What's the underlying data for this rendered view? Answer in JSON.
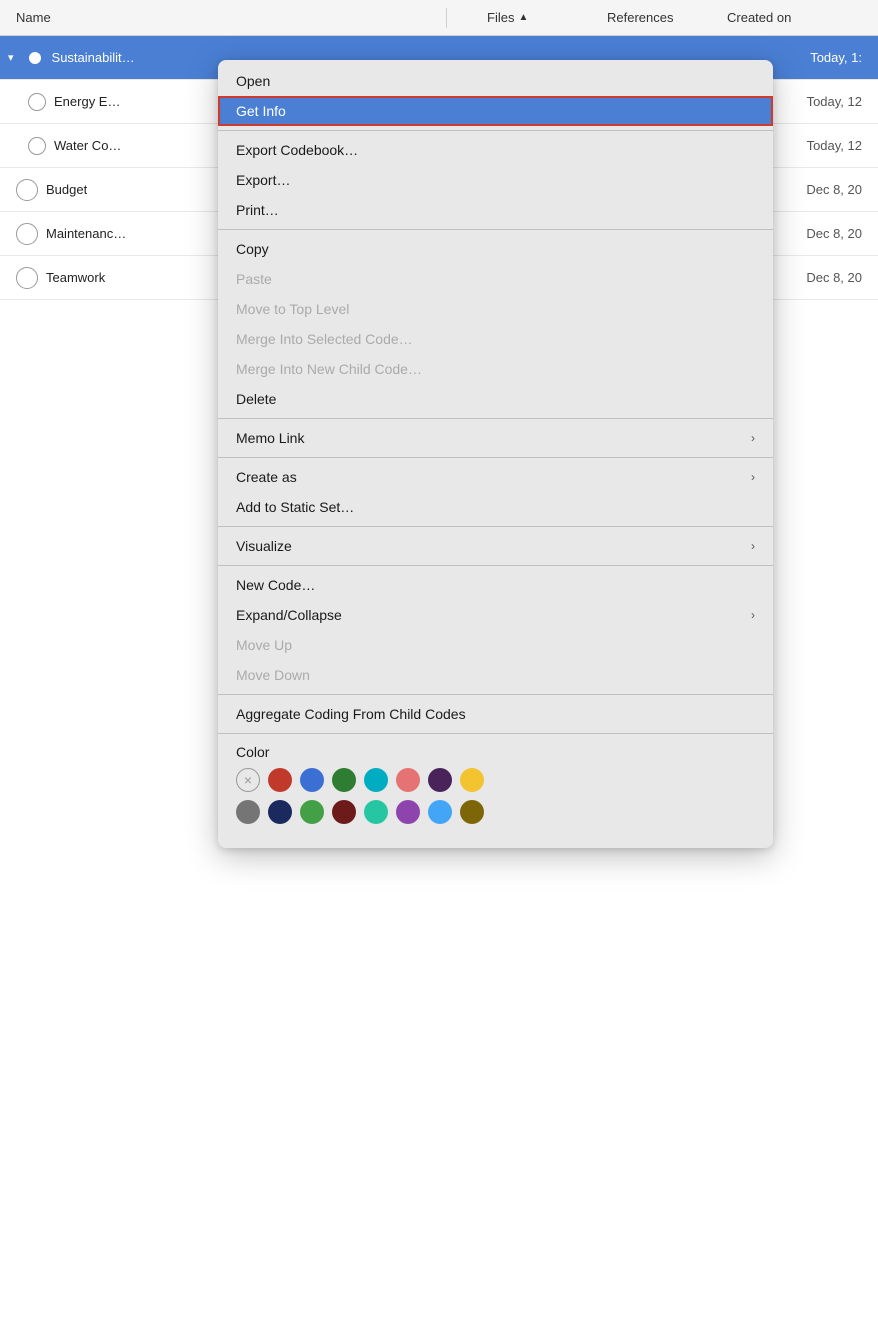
{
  "header": {
    "col_name": "Name",
    "col_files": "Files",
    "col_files_arrow": "↑",
    "col_references": "References",
    "col_created": "Created on"
  },
  "rows": [
    {
      "id": "sustainability",
      "label": "Sustainabilit…",
      "date": "Today, 1:",
      "selected": true,
      "expanded": true,
      "circle_type": "blue_filled"
    },
    {
      "id": "energy",
      "label": "Energy E…",
      "date": "Today, 12",
      "selected": false,
      "circle_type": "empty"
    },
    {
      "id": "water",
      "label": "Water Co…",
      "date": "Today, 12",
      "selected": false,
      "circle_type": "empty"
    },
    {
      "id": "budget",
      "label": "Budget",
      "date": "Dec 8, 20",
      "selected": false,
      "circle_type": "empty_large"
    },
    {
      "id": "maintenance",
      "label": "Maintenanc…",
      "date": "Dec 8, 20",
      "selected": false,
      "circle_type": "empty_large"
    },
    {
      "id": "teamwork",
      "label": "Teamwork",
      "date": "Dec 8, 20",
      "selected": false,
      "circle_type": "empty_large"
    }
  ],
  "context_menu": {
    "items": [
      {
        "id": "open",
        "label": "Open",
        "type": "normal",
        "highlighted": false,
        "disabled": false,
        "has_arrow": false
      },
      {
        "id": "get-info",
        "label": "Get Info",
        "type": "normal",
        "highlighted": true,
        "disabled": false,
        "has_arrow": false
      },
      {
        "id": "sep1",
        "type": "separator"
      },
      {
        "id": "export-codebook",
        "label": "Export Codebook…",
        "type": "normal",
        "highlighted": false,
        "disabled": false,
        "has_arrow": false
      },
      {
        "id": "export",
        "label": "Export…",
        "type": "normal",
        "highlighted": false,
        "disabled": false,
        "has_arrow": false
      },
      {
        "id": "print",
        "label": "Print…",
        "type": "normal",
        "highlighted": false,
        "disabled": false,
        "has_arrow": false
      },
      {
        "id": "sep2",
        "type": "separator"
      },
      {
        "id": "copy",
        "label": "Copy",
        "type": "normal",
        "highlighted": false,
        "disabled": false,
        "has_arrow": false
      },
      {
        "id": "paste",
        "label": "Paste",
        "type": "normal",
        "highlighted": false,
        "disabled": true,
        "has_arrow": false
      },
      {
        "id": "move-top",
        "label": "Move to Top Level",
        "type": "normal",
        "highlighted": false,
        "disabled": true,
        "has_arrow": false
      },
      {
        "id": "merge-selected",
        "label": "Merge Into Selected Code…",
        "type": "normal",
        "highlighted": false,
        "disabled": true,
        "has_arrow": false
      },
      {
        "id": "merge-new-child",
        "label": "Merge Into New Child Code…",
        "type": "normal",
        "highlighted": false,
        "disabled": true,
        "has_arrow": false
      },
      {
        "id": "delete",
        "label": "Delete",
        "type": "normal",
        "highlighted": false,
        "disabled": false,
        "has_arrow": false
      },
      {
        "id": "sep3",
        "type": "separator"
      },
      {
        "id": "memo-link",
        "label": "Memo Link",
        "type": "arrow",
        "highlighted": false,
        "disabled": false,
        "has_arrow": true
      },
      {
        "id": "sep4",
        "type": "separator"
      },
      {
        "id": "create-as",
        "label": "Create as",
        "type": "arrow",
        "highlighted": false,
        "disabled": false,
        "has_arrow": true
      },
      {
        "id": "add-static-set",
        "label": "Add to Static Set…",
        "type": "normal",
        "highlighted": false,
        "disabled": false,
        "has_arrow": false
      },
      {
        "id": "sep5",
        "type": "separator"
      },
      {
        "id": "visualize",
        "label": "Visualize",
        "type": "arrow",
        "highlighted": false,
        "disabled": false,
        "has_arrow": true
      },
      {
        "id": "sep6",
        "type": "separator"
      },
      {
        "id": "new-code",
        "label": "New Code…",
        "type": "normal",
        "highlighted": false,
        "disabled": false,
        "has_arrow": false
      },
      {
        "id": "expand-collapse",
        "label": "Expand/Collapse",
        "type": "arrow",
        "highlighted": false,
        "disabled": false,
        "has_arrow": true
      },
      {
        "id": "move-up",
        "label": "Move Up",
        "type": "normal",
        "highlighted": false,
        "disabled": true,
        "has_arrow": false
      },
      {
        "id": "move-down",
        "label": "Move Down",
        "type": "normal",
        "highlighted": false,
        "disabled": true,
        "has_arrow": false
      },
      {
        "id": "sep7",
        "type": "separator"
      },
      {
        "id": "aggregate",
        "label": "Aggregate Coding From Child Codes",
        "type": "normal",
        "highlighted": false,
        "disabled": false,
        "has_arrow": false
      },
      {
        "id": "sep8",
        "type": "separator"
      }
    ],
    "color_section": {
      "label": "Color",
      "row1": [
        {
          "id": "none",
          "color": "none"
        },
        {
          "id": "red-dark",
          "color": "#c0392b"
        },
        {
          "id": "blue",
          "color": "#3b6fd4"
        },
        {
          "id": "green-dark",
          "color": "#2e7d32"
        },
        {
          "id": "teal",
          "color": "#00acc1"
        },
        {
          "id": "pink",
          "color": "#e57373"
        },
        {
          "id": "purple-dark",
          "color": "#4a235a"
        },
        {
          "id": "yellow",
          "color": "#f4c430"
        }
      ],
      "row2": [
        {
          "id": "gray",
          "color": "#757575"
        },
        {
          "id": "navy",
          "color": "#1a2a5e"
        },
        {
          "id": "green",
          "color": "#43a047"
        },
        {
          "id": "maroon",
          "color": "#6d1a1a"
        },
        {
          "id": "mint",
          "color": "#26c6a2"
        },
        {
          "id": "mauve",
          "color": "#8e44ad"
        },
        {
          "id": "sky-blue",
          "color": "#42a5f5"
        },
        {
          "id": "olive",
          "color": "#7d6608"
        }
      ]
    }
  }
}
